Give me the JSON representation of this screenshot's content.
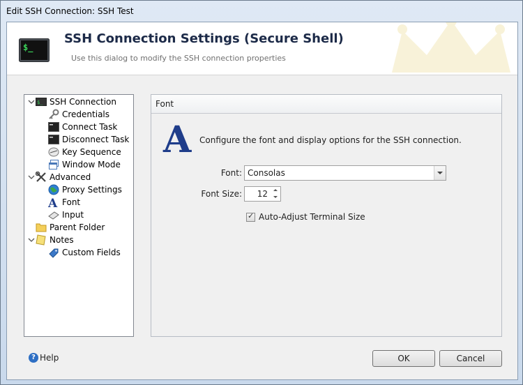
{
  "window": {
    "title": "Edit SSH Connection: SSH Test"
  },
  "header": {
    "title": "SSH Connection Settings (Secure Shell)",
    "subtitle": "Use this dialog to modify the SSH connection properties"
  },
  "tree": {
    "items": [
      {
        "label": "SSH Connection",
        "icon": "terminal-icon"
      },
      {
        "label": "Credentials",
        "icon": "key-icon"
      },
      {
        "label": "Connect Task",
        "icon": "console-icon"
      },
      {
        "label": "Disconnect Task",
        "icon": "console-icon"
      },
      {
        "label": "Key Sequence",
        "icon": "keyboard-icon"
      },
      {
        "label": "Window Mode",
        "icon": "window-icon"
      },
      {
        "label": "Advanced",
        "icon": "tools-icon"
      },
      {
        "label": "Proxy Settings",
        "icon": "globe-icon"
      },
      {
        "label": "Font",
        "icon": "font-icon"
      },
      {
        "label": "Input",
        "icon": "keyboard-input-icon"
      },
      {
        "label": "Parent Folder",
        "icon": "folder-icon"
      },
      {
        "label": "Notes",
        "icon": "notes-icon"
      },
      {
        "label": "Custom Fields",
        "icon": "tag-icon"
      }
    ]
  },
  "panel": {
    "title": "Font",
    "description": "Configure the font and display options for the SSH connection.",
    "font_label": "Font:",
    "font_value": "Consolas",
    "size_label": "Font Size:",
    "size_value": "12",
    "auto_adjust_label": "Auto-Adjust Terminal Size",
    "auto_adjust_checked": true,
    "big_icon_letter": "A"
  },
  "footer": {
    "help_label": "Help",
    "ok_label": "OK",
    "cancel_label": "Cancel"
  },
  "colors": {
    "accent": "#1f3d8a",
    "title": "#1c2a48"
  }
}
